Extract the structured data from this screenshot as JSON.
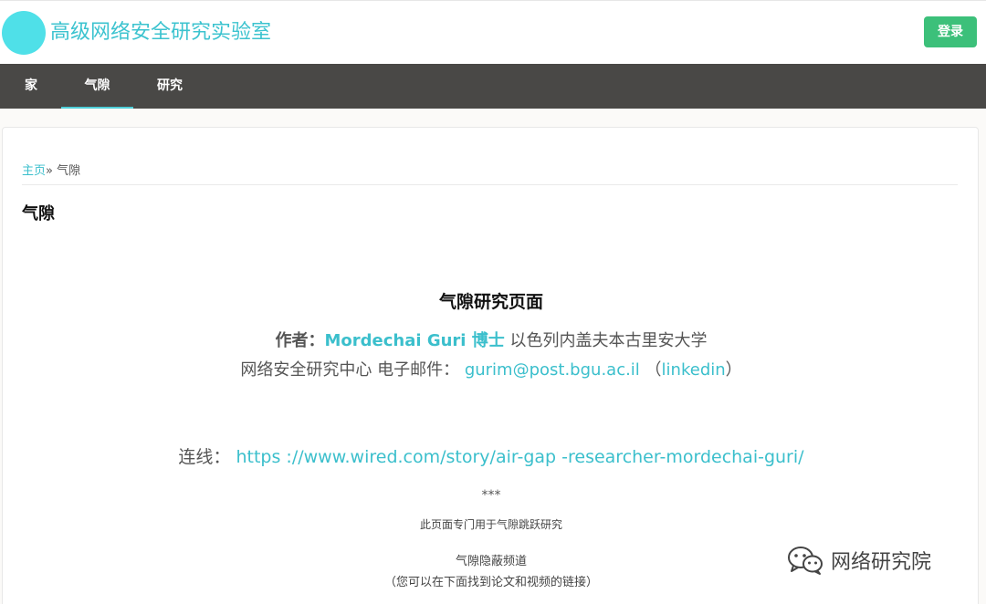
{
  "header": {
    "site_title": "高级网络安全研究实验室",
    "login_label": "登录"
  },
  "nav": {
    "items": [
      {
        "label": "家"
      },
      {
        "label": "气隙"
      },
      {
        "label": "研究"
      }
    ],
    "active_index": 1
  },
  "breadcrumb": {
    "home_label": "主页",
    "separator": "» ",
    "current": "气隙"
  },
  "page_title": "气隙",
  "content": {
    "heading": "气隙研究页面",
    "author_label": "作者：",
    "author_name": "Mordechai Guri 博士",
    "affiliation": "以色列内盖夫本古里安大学",
    "center_email_label": "网络安全研究中心 电子邮件：",
    "email": "gurim@post.bgu.ac.il",
    "paren_open": "（",
    "linkedin": "linkedin",
    "paren_close": "）",
    "connect_label": "连线：",
    "connect_url": "https ://www.wired.com/story/air-gap -researcher-mordechai-guri/",
    "stars": "***",
    "dedicated": "此页面专门用于气隙跳跃研究",
    "covert_channels": "气隙隐蔽频道",
    "links_hint": "（您可以在下面找到论文和视频的链接）"
  },
  "watermark": {
    "text": "网络研究院",
    "icon": "wechat-icon"
  },
  "colors": {
    "accent": "#3bbfcc",
    "logo": "#4fe0e8",
    "login": "#3cc07a",
    "nav_bg": "#494846"
  }
}
